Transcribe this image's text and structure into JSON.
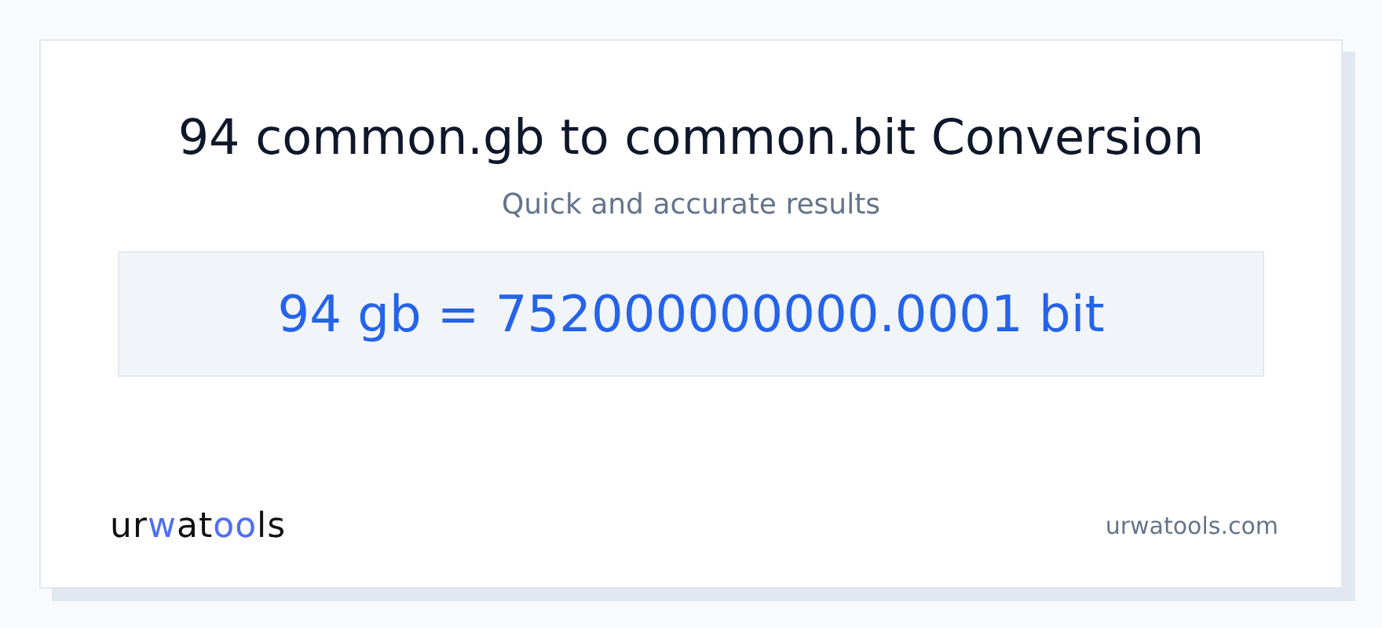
{
  "title": "94 common.gb to common.bit Conversion",
  "subtitle": "Quick and accurate results",
  "result": "94 gb = 752000000000.0001 bit",
  "footer": {
    "logo": [
      {
        "text": "ur",
        "accent": false
      },
      {
        "text": "w",
        "accent": true
      },
      {
        "text": "at",
        "accent": false
      },
      {
        "text": "oo",
        "accent": true
      },
      {
        "text": "ls",
        "accent": false
      }
    ],
    "site": "urwatools.com"
  }
}
